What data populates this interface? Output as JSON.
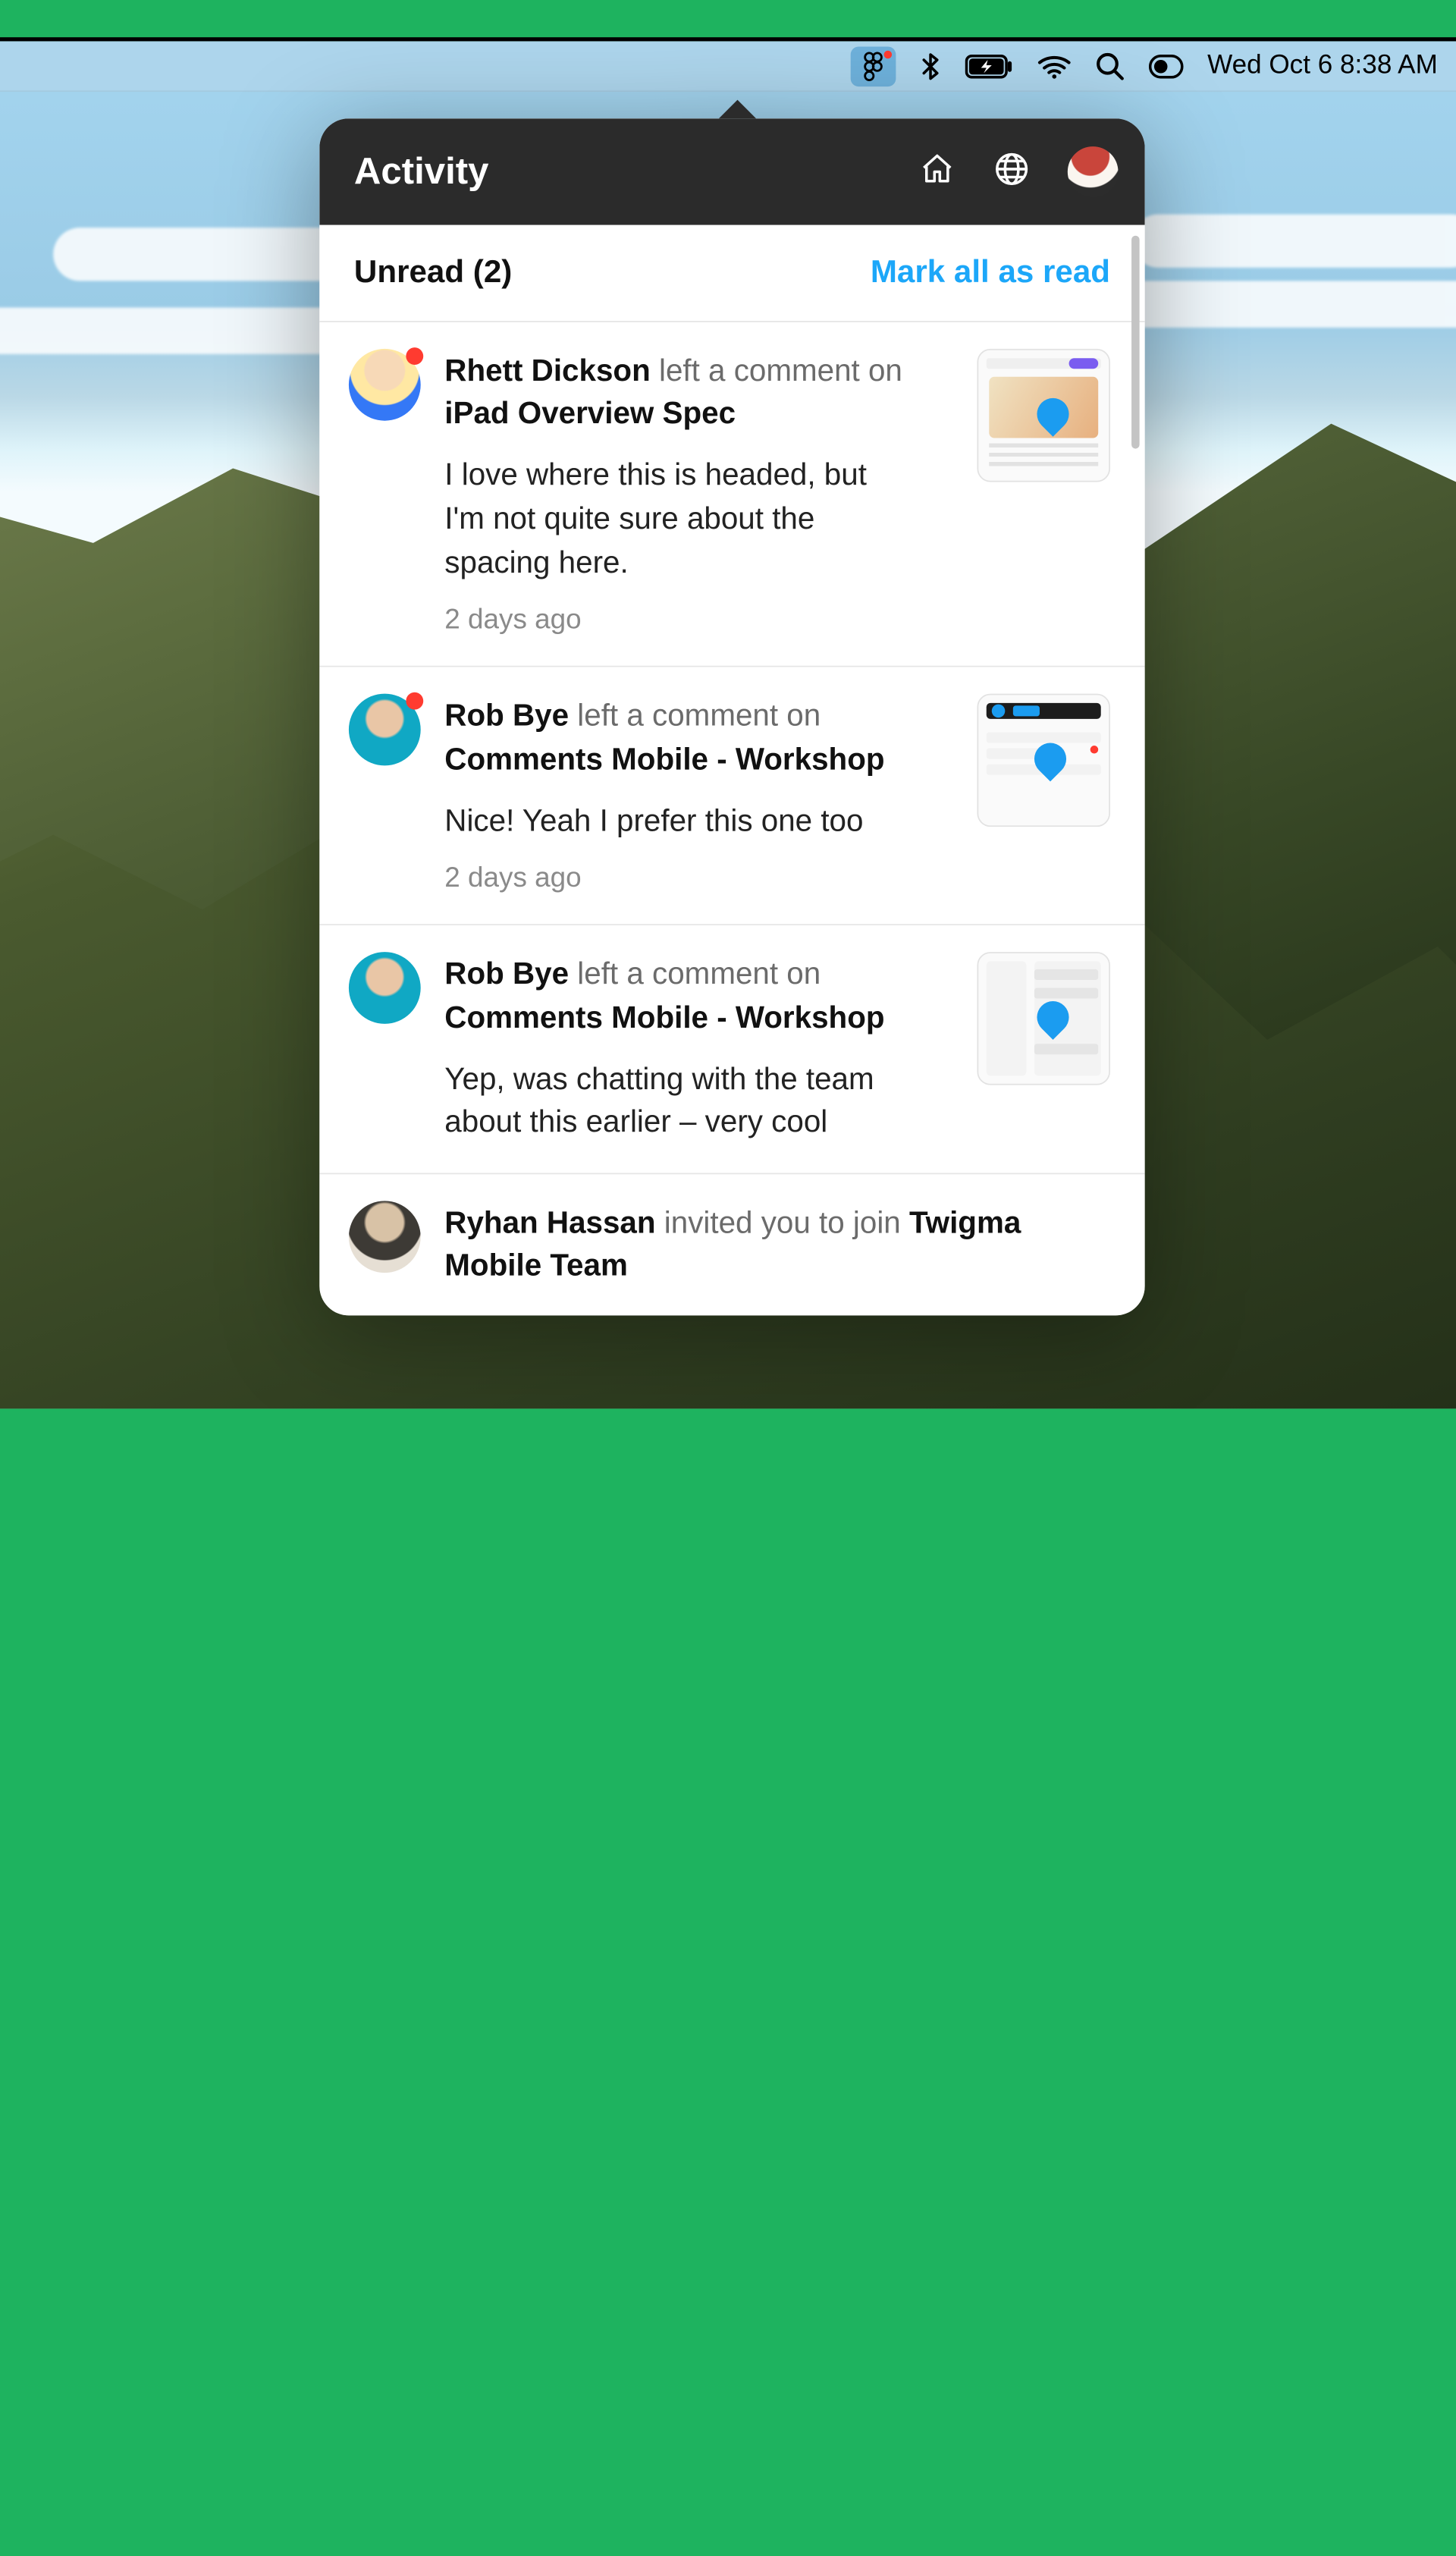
{
  "menubar": {
    "datetime": "Wed Oct 6  8:38 AM"
  },
  "panel": {
    "title": "Activity",
    "unread_label": "Unread (2)",
    "mark_all_label": "Mark all as read"
  },
  "items": [
    {
      "actor": "Rhett Dickson",
      "action": "left a comment on",
      "file": "iPad Overview Spec",
      "body": "I love where this is headed, but I'm not quite sure about the spacing here.",
      "time": "2 days ago",
      "unread": true,
      "has_thumb": true
    },
    {
      "actor": "Rob Bye",
      "action": "left a comment on",
      "file": "Comments Mobile - Workshop",
      "body": "Nice! Yeah I prefer this one too",
      "time": "2 days ago",
      "unread": true,
      "has_thumb": true
    },
    {
      "actor": "Rob Bye",
      "action": "left a comment on",
      "file": "Comments Mobile - Workshop",
      "body": "Yep, was chatting with the team about this earlier – very cool",
      "time": "",
      "unread": false,
      "has_thumb": true
    },
    {
      "actor": "Ryhan Hassan",
      "action": "invited you to join",
      "file": "Twigma Mobile Team",
      "body": "",
      "time": "",
      "unread": false,
      "has_thumb": false
    }
  ]
}
